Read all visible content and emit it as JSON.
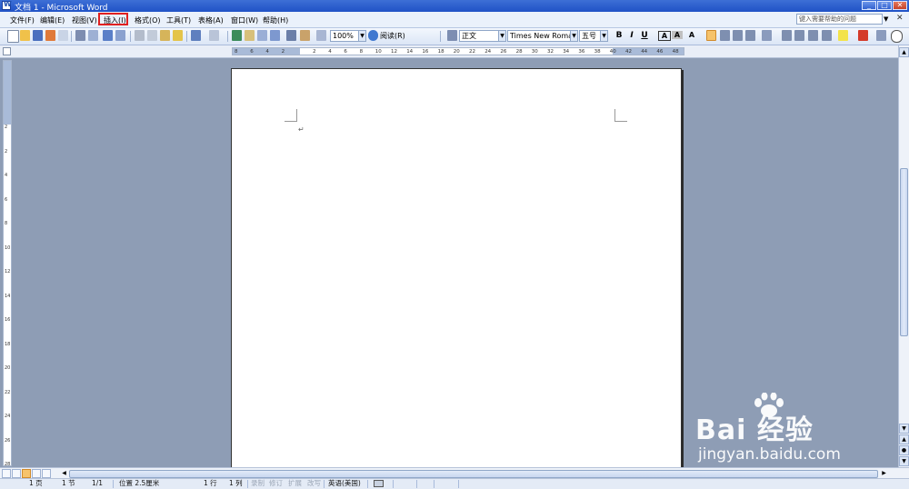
{
  "window": {
    "title": "文档 1 - Microsoft Word",
    "min": "_",
    "max": "□",
    "close": "✕"
  },
  "menu": {
    "items": [
      "文件(F)",
      "编辑(E)",
      "视图(V)",
      "插入(I)",
      "格式(O)",
      "工具(T)",
      "表格(A)",
      "窗口(W)",
      "帮助(H)"
    ],
    "highlighted": "插入(I)",
    "help_placeholder": "键入需要帮助的问题",
    "help_arrow": "▼",
    "close": "✕"
  },
  "toolbar": {
    "zoom": "100%",
    "reading": "阅读(R)",
    "style": "正文",
    "font": "Times New Roman",
    "size": "五号",
    "bold": "B",
    "italic": "I",
    "underline": "U",
    "char_border": "A",
    "char_shade": "A",
    "scale": "A",
    "combo_arrow": "▼",
    "help": "?"
  },
  "ruler": {
    "h_ticks": [
      "8",
      "6",
      "4",
      "2",
      "",
      "2",
      "4",
      "6",
      "8",
      "10",
      "12",
      "14",
      "16",
      "18",
      "20",
      "22",
      "24",
      "26",
      "28",
      "30",
      "32",
      "34",
      "36",
      "38",
      "40",
      "42",
      "44",
      "46",
      "48"
    ],
    "v_ticks": [
      "2",
      "2",
      "4",
      "6",
      "8",
      "10",
      "12",
      "14",
      "16",
      "18",
      "20",
      "22",
      "24",
      "26",
      "28"
    ]
  },
  "document": {
    "paragraph_mark": "↵"
  },
  "scroll": {
    "up": "▲",
    "down": "▼",
    "prev": "▲",
    "select": "●",
    "next": "▼",
    "left": "◀",
    "right": "▶"
  },
  "status": {
    "page": "1 页",
    "section": "1 节",
    "page_of": "1/1",
    "position": "位置 2.5厘米",
    "line": "1 行",
    "column": "1 列",
    "rec": "录制",
    "trk": "修订",
    "ext": "扩展",
    "ovr": "改写",
    "language": "英语(美国)"
  },
  "watermark": {
    "logo": "Bai 经验",
    "url": "jingyan.baidu.com"
  },
  "colors": {
    "titlebar": "#2a5bcc",
    "workspace": "#8e9db5",
    "highlight_border": "#e02020",
    "active_button": "#f6c36b"
  }
}
